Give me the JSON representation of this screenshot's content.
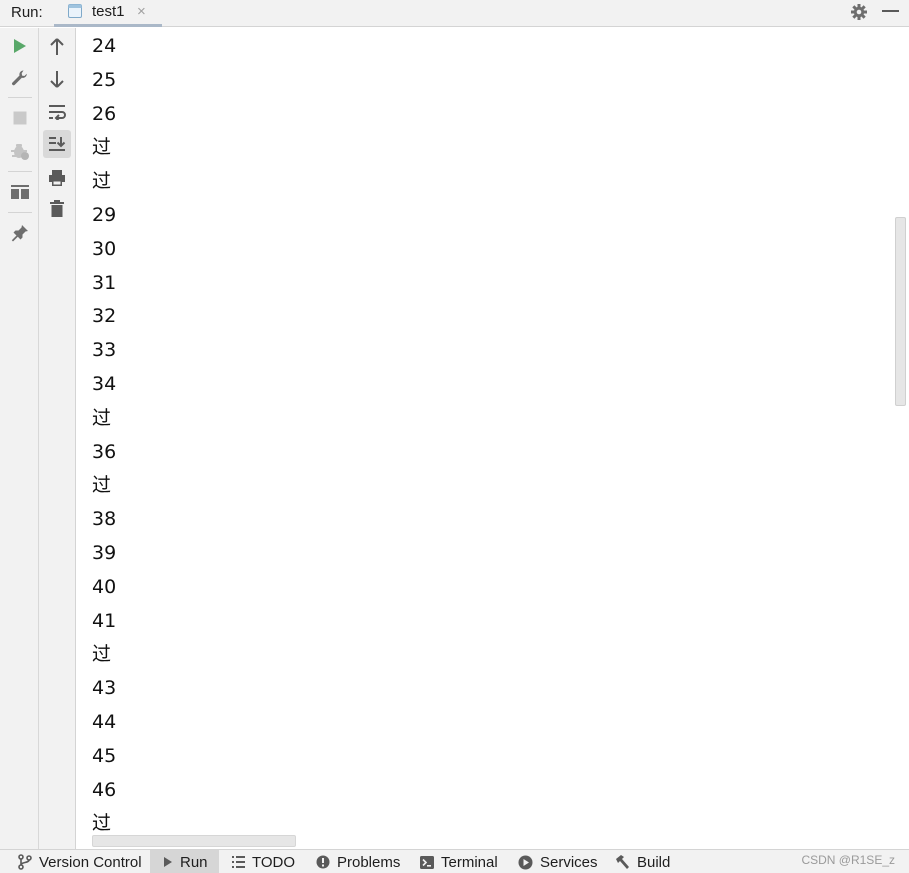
{
  "header": {
    "run_label": "Run:",
    "tab": {
      "label": "test1",
      "close": "×"
    }
  },
  "toolbar_left": {
    "icons": [
      "run-icon",
      "wrench-icon",
      "stop-icon",
      "debug-icon",
      "layout-icon",
      "pin-icon"
    ]
  },
  "toolbar_right": {
    "icons": [
      "arrow-up-icon",
      "arrow-down-icon",
      "soft-wrap-icon",
      "scroll-to-end-icon",
      "print-icon",
      "trash-icon"
    ]
  },
  "console": {
    "lines": [
      "24",
      "25",
      "26",
      "过",
      "过",
      "29",
      "30",
      "31",
      "32",
      "33",
      "34",
      "过",
      "36",
      "过",
      "38",
      "39",
      "40",
      "41",
      "过",
      "43",
      "44",
      "45",
      "46",
      "过"
    ]
  },
  "bottom_bar": {
    "items": [
      {
        "label": "Version Control",
        "icon": "branch-icon"
      },
      {
        "label": "Run",
        "icon": "play-icon",
        "active": true
      },
      {
        "label": "TODO",
        "icon": "list-icon"
      },
      {
        "label": "Problems",
        "icon": "alert-icon"
      },
      {
        "label": "Terminal",
        "icon": "terminal-icon"
      },
      {
        "label": "Services",
        "icon": "services-icon"
      },
      {
        "label": "Build",
        "icon": "hammer-icon"
      }
    ],
    "watermark": "CSDN @R1SE_z"
  },
  "colors": {
    "run_green": "#59a869",
    "icon_gray": "#6e6e6e",
    "panel_bg": "#f2f2f2"
  }
}
